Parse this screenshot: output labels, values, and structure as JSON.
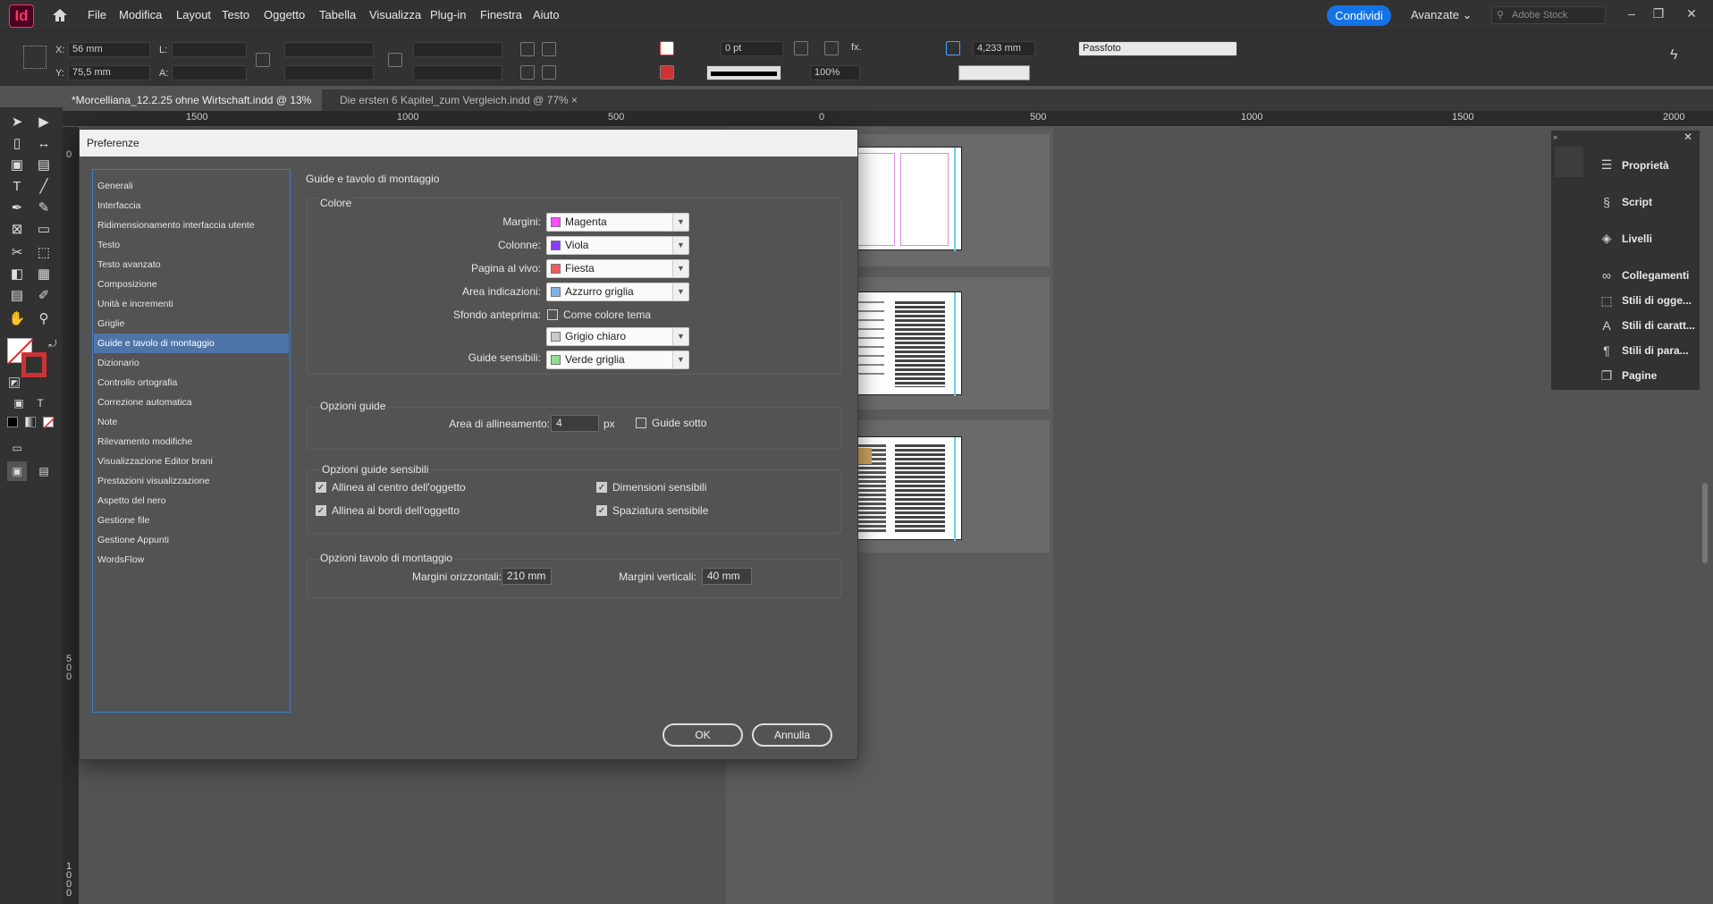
{
  "app": {
    "logo": "Id",
    "home_icon": "home-icon"
  },
  "menu": [
    "File",
    "Modifica",
    "Layout",
    "Testo",
    "Oggetto",
    "Tabella",
    "Visualizza",
    "Plug-in",
    "Finestra",
    "Aiuto"
  ],
  "header": {
    "share": "Condividi",
    "workspace": "Avanzate",
    "search_placeholder": "Adobe Stock"
  },
  "control": {
    "x_label": "X:",
    "x_value": "56 mm",
    "y_label": "Y:",
    "y_value": "75,5 mm",
    "w_label": "L:",
    "h_label": "A:",
    "stroke_weight": "0 pt",
    "zoom": "100%",
    "size_value": "4,233 mm",
    "fit_value": "Passfoto"
  },
  "tabs": [
    {
      "label": "*Morcelliana_12.2.25 ohne Wirtschaft.indd @ 13%"
    },
    {
      "label": "Die ersten 6 Kapitel_zum Vergleich.indd @ 77%"
    }
  ],
  "ruler": [
    "1500",
    "1000",
    "500",
    "0",
    "500",
    "1000",
    "1500",
    "2000"
  ],
  "vruler": [
    "0",
    "500",
    "1000"
  ],
  "panels": [
    {
      "label": "Proprietà",
      "icon": "properties-icon"
    },
    {
      "label": "Script",
      "icon": "script-icon"
    },
    {
      "label": "Livelli",
      "icon": "layers-icon"
    },
    {
      "label": "Collegamenti",
      "icon": "links-icon"
    },
    {
      "label": "Stili di ogge...",
      "icon": "object-styles-icon"
    },
    {
      "label": "Stili di caratt...",
      "icon": "character-styles-icon"
    },
    {
      "label": "Stili di para...",
      "icon": "paragraph-styles-icon"
    },
    {
      "label": "Pagine",
      "icon": "pages-icon"
    }
  ],
  "dialog": {
    "title": "Preferenze",
    "categories": [
      "Generali",
      "Interfaccia",
      "Ridimensionamento interfaccia utente",
      "Testo",
      "Testo avanzato",
      "Composizione",
      "Unità e incrementi",
      "Griglie",
      "Guide e tavolo di montaggio",
      "Dizionario",
      "Controllo ortografia",
      "Correzione automatica",
      "Note",
      "Rilevamento modifiche",
      "Visualizzazione Editor brani",
      "Prestazioni visualizzazione",
      "Aspetto del nero",
      "Gestione file",
      "Gestione Appunti",
      "WordsFlow"
    ],
    "selected_category": "Guide e tavolo di montaggio",
    "section_title": "Guide e tavolo di montaggio",
    "colore": {
      "title": "Colore",
      "margini": {
        "label": "Margini:",
        "value": "Magenta",
        "color": "#ff4dff"
      },
      "colonne": {
        "label": "Colonne:",
        "value": "Viola",
        "color": "#8a3dff"
      },
      "pagina": {
        "label": "Pagina al vivo:",
        "value": "Fiesta",
        "color": "#f05a5a"
      },
      "area": {
        "label": "Area indicazioni:",
        "value": "Azzurro griglia",
        "color": "#7fb2e0"
      },
      "sfondo": {
        "label": "Sfondo anteprima:",
        "checkbox": "Come colore tema",
        "value": "Grigio chiaro",
        "color": "#c8c8c8"
      },
      "sensibili": {
        "label": "Guide sensibili:",
        "value": "Verde griglia",
        "color": "#8fe08f"
      }
    },
    "opzioni_guide": {
      "title": "Opzioni guide",
      "area_label": "Area di allineamento:",
      "area_value": "4",
      "unit": "px",
      "guide_sotto": "Guide sotto"
    },
    "opzioni_sensibili": {
      "title": "Opzioni guide sensibili",
      "centro": "Allinea al centro dell'oggetto",
      "bordi": "Allinea ai bordi dell'oggetto",
      "dimensioni": "Dimensioni sensibili",
      "spaziatura": "Spaziatura sensibile"
    },
    "tavolo": {
      "title": "Opzioni tavolo di montaggio",
      "orizz_label": "Margini orizzontali:",
      "orizz_value": "210 mm",
      "vert_label": "Margini verticali:",
      "vert_value": "40 mm"
    },
    "ok": "OK",
    "cancel": "Annulla"
  }
}
